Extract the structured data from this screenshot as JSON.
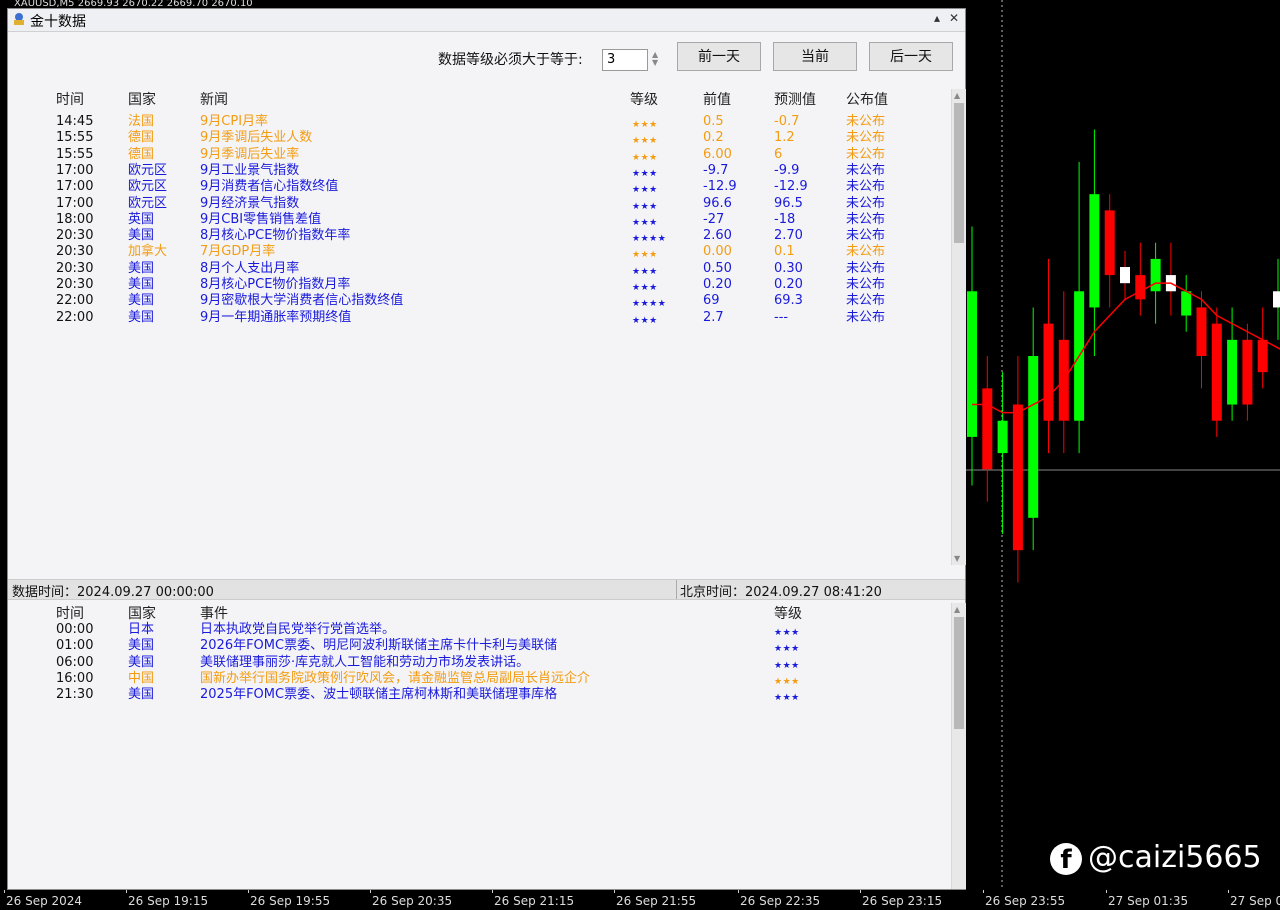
{
  "chart_header": "XAUUSD,M5  2669.93 2670.22 2669.70 2670.10",
  "window": {
    "title": "金十数据",
    "minimize_label": "▴",
    "close_label": "✕"
  },
  "filter": {
    "label": "数据等级必须大于等于:",
    "value": "3"
  },
  "buttons": {
    "prev_day": "前一天",
    "current": "当前",
    "next_day": "后一天"
  },
  "news_table": {
    "headers": {
      "time": "时间",
      "country": "国家",
      "news": "新闻",
      "level": "等级",
      "previous": "前值",
      "forecast": "预测值",
      "actual": "公布值"
    },
    "rows": [
      {
        "time": "14:45",
        "country": "法国",
        "news": "9月CPI月率",
        "stars": "★★★",
        "previous": "0.5",
        "forecast": "-0.7",
        "actual": "未公布",
        "color": "orange"
      },
      {
        "time": "15:55",
        "country": "德国",
        "news": "9月季调后失业人数",
        "stars": "★★★",
        "previous": "0.2",
        "forecast": "1.2",
        "actual": "未公布",
        "color": "orange"
      },
      {
        "time": "15:55",
        "country": "德国",
        "news": "9月季调后失业率",
        "stars": "★★★",
        "previous": "6.00",
        "forecast": "6",
        "actual": "未公布",
        "color": "orange"
      },
      {
        "time": "17:00",
        "country": "欧元区",
        "news": "9月工业景气指数",
        "stars": "★★★",
        "previous": "-9.7",
        "forecast": "-9.9",
        "actual": "未公布",
        "color": "blue"
      },
      {
        "time": "17:00",
        "country": "欧元区",
        "news": "9月消费者信心指数终值",
        "stars": "★★★",
        "previous": "-12.9",
        "forecast": "-12.9",
        "actual": "未公布",
        "color": "blue"
      },
      {
        "time": "17:00",
        "country": "欧元区",
        "news": "9月经济景气指数",
        "stars": "★★★",
        "previous": "96.6",
        "forecast": "96.5",
        "actual": "未公布",
        "color": "blue"
      },
      {
        "time": "18:00",
        "country": "英国",
        "news": "9月CBI零售销售差值",
        "stars": "★★★",
        "previous": "-27",
        "forecast": "-18",
        "actual": "未公布",
        "color": "blue"
      },
      {
        "time": "20:30",
        "country": "美国",
        "news": "8月核心PCE物价指数年率",
        "stars": "★★★★",
        "previous": "2.60",
        "forecast": "2.70",
        "actual": "未公布",
        "color": "blue"
      },
      {
        "time": "20:30",
        "country": "加拿大",
        "news": "7月GDP月率",
        "stars": "★★★",
        "previous": "0.00",
        "forecast": "0.1",
        "actual": "未公布",
        "color": "orange"
      },
      {
        "time": "20:30",
        "country": "美国",
        "news": "8月个人支出月率",
        "stars": "★★★",
        "previous": "0.50",
        "forecast": "0.30",
        "actual": "未公布",
        "color": "blue"
      },
      {
        "time": "20:30",
        "country": "美国",
        "news": "8月核心PCE物价指数月率",
        "stars": "★★★",
        "previous": "0.20",
        "forecast": "0.20",
        "actual": "未公布",
        "color": "blue"
      },
      {
        "time": "22:00",
        "country": "美国",
        "news": "9月密歇根大学消费者信心指数终值",
        "stars": "★★★★",
        "previous": "69",
        "forecast": "69.3",
        "actual": "未公布",
        "color": "blue"
      },
      {
        "time": "22:00",
        "country": "美国",
        "news": "9月一年期通胀率预期终值",
        "stars": "★★★",
        "previous": "2.7",
        "forecast": "---",
        "actual": "未公布",
        "color": "blue"
      }
    ]
  },
  "status": {
    "data_time": "数据时间：2024.09.27 00:00:00",
    "beijing_time": "北京时间：2024.09.27 08:41:20"
  },
  "events_table": {
    "headers": {
      "time": "时间",
      "country": "国家",
      "event": "事件",
      "level": "等级"
    },
    "rows": [
      {
        "time": "00:00",
        "country": "日本",
        "event": "日本执政党自民党举行党首选举。",
        "stars": "★★★",
        "color": "blue"
      },
      {
        "time": "01:00",
        "country": "美国",
        "event": "2026年FOMC票委、明尼阿波利斯联储主席卡什卡利与美联储",
        "stars": "★★★",
        "color": "blue"
      },
      {
        "time": "06:00",
        "country": "美国",
        "event": "美联储理事丽莎·库克就人工智能和劳动力市场发表讲话。",
        "stars": "★★★",
        "color": "blue"
      },
      {
        "time": "16:00",
        "country": "中国",
        "event": "国新办举行国务院政策例行吹风会，请金融监管总局副局长肖远企介",
        "stars": "★★★",
        "color": "orange"
      },
      {
        "time": "21:30",
        "country": "美国",
        "event": "2025年FOMC票委、波士顿联储主席柯林斯和美联储理事库格",
        "stars": "★★★",
        "color": "blue"
      }
    ]
  },
  "time_axis": [
    "26 Sep 2024",
    "26 Sep 19:15",
    "26 Sep 19:55",
    "26 Sep 20:35",
    "26 Sep 21:15",
    "26 Sep 21:55",
    "26 Sep 22:35",
    "26 Sep 23:15",
    "26 Sep 23:55",
    "27 Sep 01:35",
    "27 Sep 0"
  ],
  "watermark": {
    "icon": "facebook-icon",
    "text": "@caizi5665",
    "fb_glyph": "f"
  },
  "colors": {
    "blue": "#1a1adc",
    "orange": "#f39c12",
    "bull": "#00ff00",
    "bear": "#ff0000",
    "ma": "#ff0000"
  },
  "candles": [
    {
      "o": 2668.6,
      "c": 2670.4,
      "h": 2671.2,
      "l": 2668.0
    },
    {
      "o": 2669.2,
      "c": 2668.2,
      "h": 2669.6,
      "l": 2667.8
    },
    {
      "o": 2668.4,
      "c": 2668.8,
      "h": 2669.4,
      "l": 2667.4
    },
    {
      "o": 2669.0,
      "c": 2667.2,
      "h": 2669.6,
      "l": 2666.8
    },
    {
      "o": 2667.6,
      "c": 2669.6,
      "h": 2670.2,
      "l": 2667.2
    },
    {
      "o": 2670.0,
      "c": 2668.8,
      "h": 2670.8,
      "l": 2668.4
    },
    {
      "o": 2669.8,
      "c": 2668.8,
      "h": 2670.4,
      "l": 2668.4
    },
    {
      "o": 2668.8,
      "c": 2670.4,
      "h": 2672.0,
      "l": 2668.4
    },
    {
      "o": 2670.2,
      "c": 2671.6,
      "h": 2672.4,
      "l": 2669.6
    },
    {
      "o": 2671.4,
      "c": 2670.6,
      "h": 2671.6,
      "l": 2670.2
    },
    {
      "o": 2670.7,
      "c": 2670.5,
      "h": 2670.9,
      "l": 2670.3
    },
    {
      "o": 2670.6,
      "c": 2670.3,
      "h": 2671.0,
      "l": 2670.1
    },
    {
      "o": 2670.4,
      "c": 2670.8,
      "h": 2671.0,
      "l": 2670.0
    },
    {
      "o": 2670.6,
      "c": 2670.4,
      "h": 2671.0,
      "l": 2670.1
    },
    {
      "o": 2670.1,
      "c": 2670.4,
      "h": 2670.6,
      "l": 2669.9
    },
    {
      "o": 2670.2,
      "c": 2669.6,
      "h": 2670.4,
      "l": 2669.2
    },
    {
      "o": 2670.0,
      "c": 2668.8,
      "h": 2670.2,
      "l": 2668.6
    },
    {
      "o": 2669.0,
      "c": 2669.8,
      "h": 2670.2,
      "l": 2668.8
    },
    {
      "o": 2669.8,
      "c": 2669.0,
      "h": 2670.0,
      "l": 2668.8
    },
    {
      "o": 2669.8,
      "c": 2669.4,
      "h": 2670.2,
      "l": 2669.2
    },
    {
      "o": 2670.2,
      "c": 2670.4,
      "h": 2670.8,
      "l": 2669.8
    },
    {
      "o": 2670.4,
      "c": 2668.8,
      "h": 2670.8,
      "l": 2668.6
    },
    {
      "o": 2669.6,
      "c": 2670.0,
      "h": 2670.2,
      "l": 2669.4
    },
    {
      "o": 2669.8,
      "c": 2670.4,
      "h": 2671.0,
      "l": 2669.4
    }
  ],
  "ma": [
    2669.0,
    2669.0,
    2668.9,
    2668.9,
    2669.0,
    2669.1,
    2669.3,
    2669.6,
    2669.9,
    2670.1,
    2670.3,
    2670.4,
    2670.5,
    2670.5,
    2670.4,
    2670.3,
    2670.1,
    2670.0,
    2669.9,
    2669.8,
    2669.7,
    2669.6,
    2669.6,
    2669.6
  ],
  "price_range": [
    2663.0,
    2674.0
  ]
}
